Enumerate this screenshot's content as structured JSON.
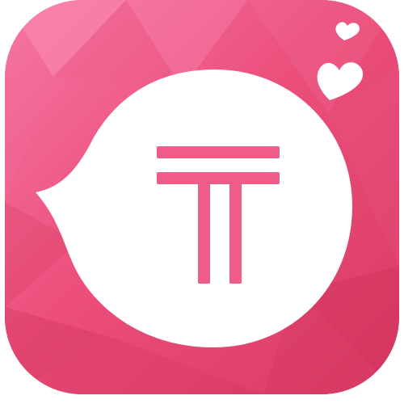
{
  "app_icon": {
    "icon_name": "speech-bubble-logo-icon",
    "colors": {
      "background_base": "#ec4f7c",
      "background_light": "#f577a3",
      "background_dark": "#d83a63",
      "facet_light": "#fb8fb7",
      "facet_dark": "#c92f57",
      "bubble": "#ffffff",
      "glyph": "#ee5c87",
      "hearts": "#ffffff"
    }
  }
}
